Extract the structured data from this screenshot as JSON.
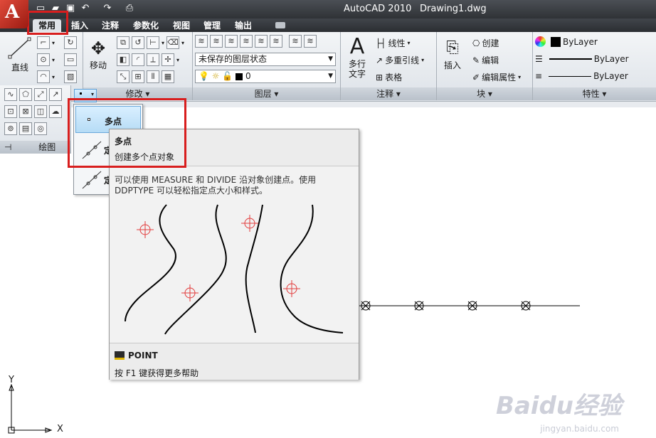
{
  "window": {
    "app_title": "AutoCAD 2010",
    "document_title": "Drawing1.dwg"
  },
  "tabs": [
    {
      "label": "常用",
      "active": true
    },
    {
      "label": "插入"
    },
    {
      "label": "注释"
    },
    {
      "label": "参数化"
    },
    {
      "label": "视图"
    },
    {
      "label": "管理"
    },
    {
      "label": "输出"
    }
  ],
  "ribbon": {
    "draw": {
      "line_label": "直线",
      "panel_title": "绘图"
    },
    "modify": {
      "move_label": "移动",
      "panel_title": "修改"
    },
    "layers": {
      "state_value": "未保存的图层状态",
      "layer_value": "0",
      "panel_title": "图层"
    },
    "annotation": {
      "multiline_text_label": "多行文字",
      "linear_label": "线性",
      "multileader_label": "多重引线",
      "table_label": "表格",
      "panel_title": "注释"
    },
    "block": {
      "insert_label": "插入",
      "create_label": "创建",
      "edit_label": "编辑",
      "edit_attr_label": "编辑属性",
      "panel_title": "块"
    },
    "properties": {
      "color_value": "ByLayer",
      "linetype_value": "ByLayer",
      "lineweight_value": "ByLayer",
      "panel_title": "特性"
    }
  },
  "dropdown": {
    "items": [
      {
        "label": "多点",
        "selected": true
      },
      {
        "label": "定"
      },
      {
        "label": "定"
      }
    ]
  },
  "tooltip": {
    "title": "多点",
    "subtitle": "创建多个点对象",
    "description": "可以使用 MEASURE 和 DIVIDE 沿对象创建点。使用 DDPTYPE 可以轻松指定点大小和样式。",
    "command": "POINT",
    "help_text": "按 F1 键获得更多帮助"
  },
  "ucs": {
    "x_label": "X",
    "y_label": "Y"
  },
  "watermark": {
    "brand": "Baidu经验",
    "url": "jingyan.baidu.com"
  },
  "colors": {
    "highlight_red": "#d81e1e",
    "point_marker_red": "#e23b3b",
    "selection_blue": "#b6dcf6"
  }
}
